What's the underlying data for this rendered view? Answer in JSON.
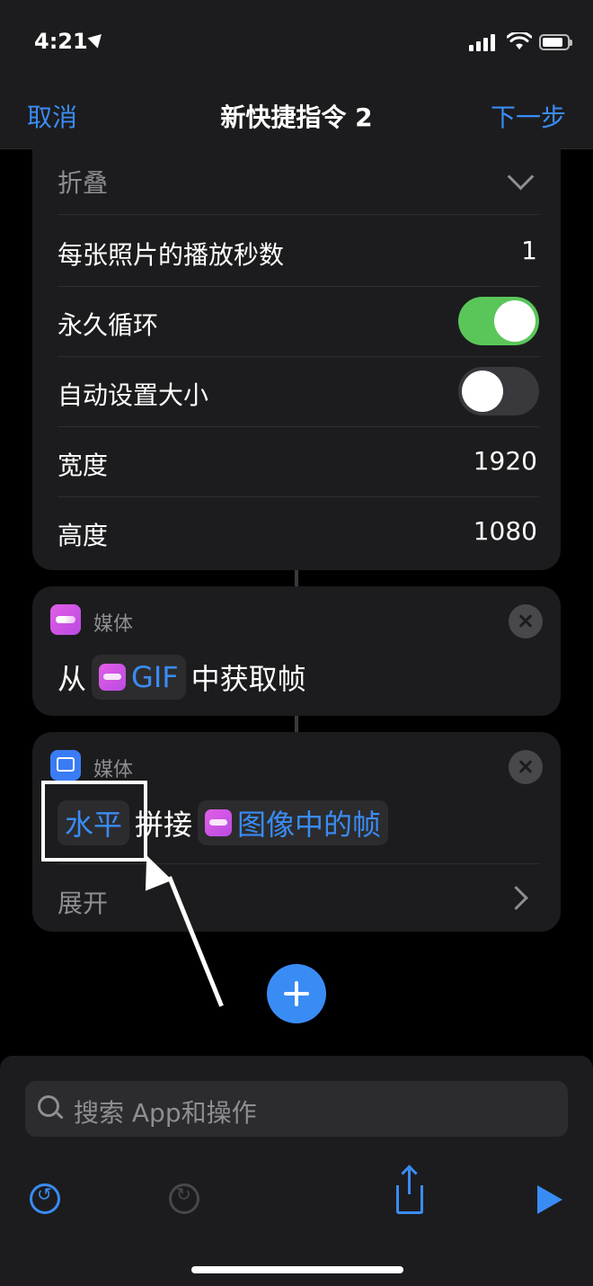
{
  "status_bar": {
    "time": "4:21"
  },
  "nav": {
    "cancel": "取消",
    "title": "新快捷指令 2",
    "next": "下一步"
  },
  "settings": {
    "collapse_label": "折叠",
    "rows": [
      {
        "label": "每张照片的播放秒数",
        "value": "1"
      },
      {
        "label": "永久循环",
        "toggle": true
      },
      {
        "label": "自动设置大小",
        "toggle": false
      },
      {
        "label": "宽度",
        "value": "1920"
      },
      {
        "label": "高度",
        "value": "1080"
      }
    ]
  },
  "action1": {
    "category": "媒体",
    "prefix": "从",
    "token": "GIF",
    "suffix": "中获取帧"
  },
  "action2": {
    "category": "媒体",
    "token1": "水平",
    "middle": "拼接",
    "token2": "图像中的帧",
    "expand": "展开"
  },
  "search": {
    "placeholder": "搜索 App和操作"
  },
  "colors": {
    "accent": "#3a8cf5",
    "toggle_on": "#5ac65a",
    "media_pink": "#d255e6",
    "media_blue": "#3a7cf5"
  }
}
